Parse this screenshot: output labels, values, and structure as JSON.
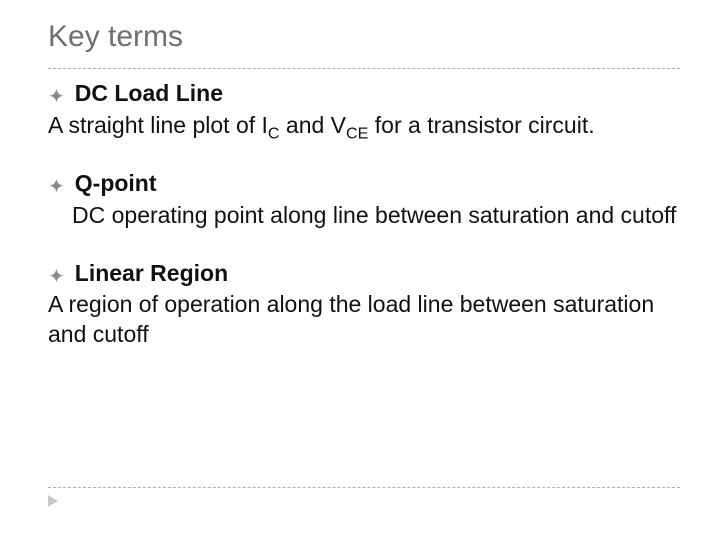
{
  "title": "Key terms",
  "bullets": [
    {
      "term": "DC Load Line",
      "def_prefix": "A straight line plot of I",
      "def_sub1": "C",
      "def_mid": " and V",
      "def_sub2": "CE",
      "def_suffix": " for a transistor circuit.",
      "indent": false
    },
    {
      "term": "Q-point",
      "def_prefix": "DC operating point along line between saturation and cutoff",
      "indent": true
    },
    {
      "term": "Linear Region",
      "def_prefix": "A region of operation along the load line between saturation and cutoff",
      "indent": false
    }
  ]
}
